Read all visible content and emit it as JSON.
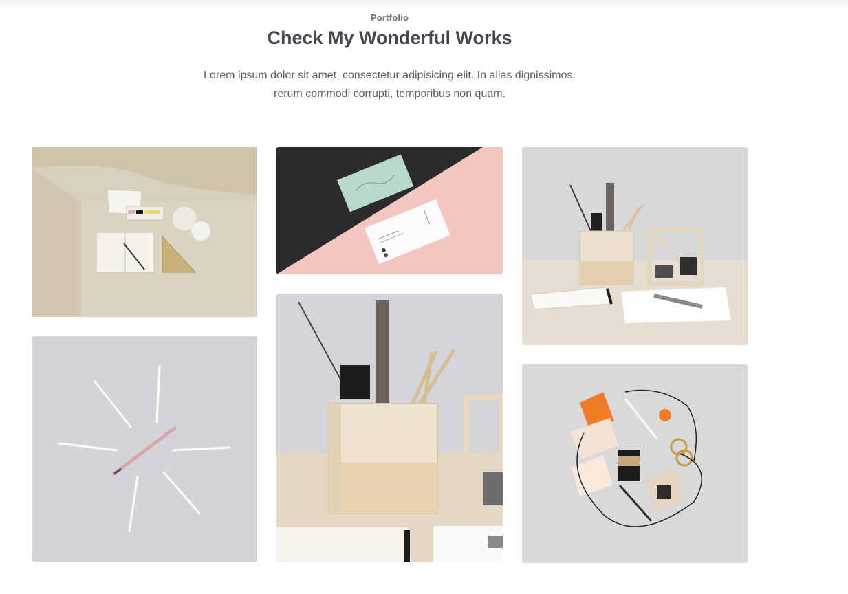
{
  "section": {
    "eyebrow": "Portfolio",
    "title": "Check My Wonderful Works",
    "description_line1": "Lorem ipsum dolor sit amet, consectetur adipisicing elit. In alias dignissimos.",
    "description_line2": "rerum commodi corrupti, temporibus non quam."
  },
  "portfolio_items": [
    {
      "subject": "desk-flatlay-photo"
    },
    {
      "subject": "business-cards-photo"
    },
    {
      "subject": "pencil-holder-photo"
    },
    {
      "subject": "pencils-circle-photo"
    },
    {
      "subject": "wooden-box-closeup-photo"
    },
    {
      "subject": "stationery-flatlay-photo"
    }
  ],
  "colors": {
    "heading": "#45494f",
    "text": "#5a5f66",
    "eyebrow": "#6f737a",
    "card_pink": "#f4c6c1",
    "card_dark": "#2b2b2b"
  }
}
